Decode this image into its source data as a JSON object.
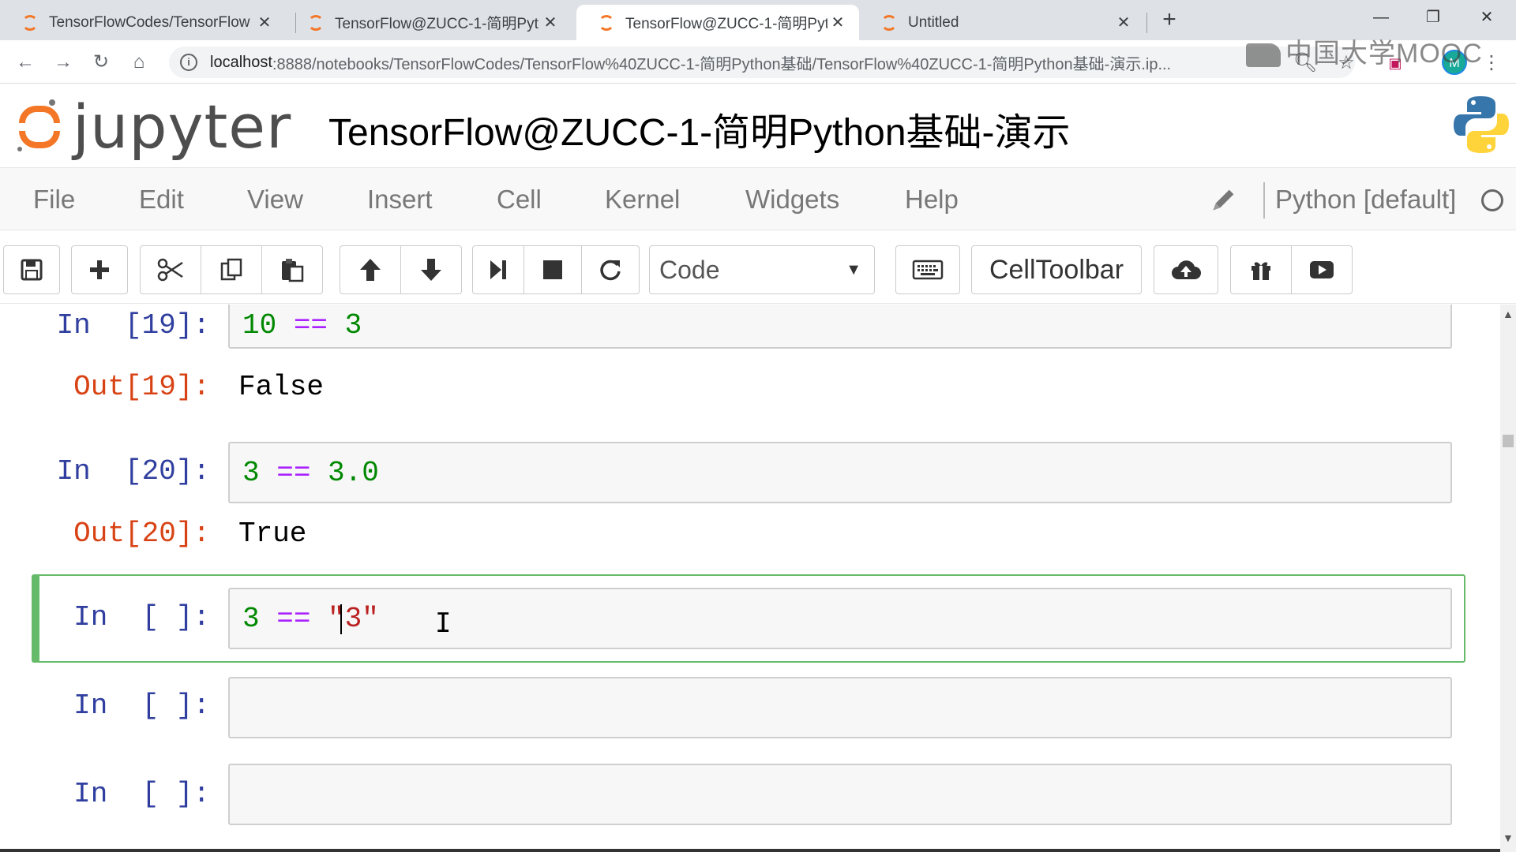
{
  "browser": {
    "tabs": [
      {
        "title": "TensorFlowCodes/TensorFlow",
        "close": "✕"
      },
      {
        "title": "TensorFlow@ZUCC-1-简明Pyt",
        "close": "✕"
      },
      {
        "title": "TensorFlow@ZUCC-1-简明Pyt",
        "close": "✕"
      },
      {
        "title": "Untitled",
        "close": "✕"
      }
    ],
    "active_tab_index": 2,
    "new_tab": "+",
    "window_controls": {
      "minimize": "—",
      "restore": "❐",
      "close": "✕"
    },
    "nav": {
      "back": "←",
      "forward": "→",
      "reload": "↻",
      "home": "⌂"
    },
    "url_host": "localhost",
    "url_path": ":8888/notebooks/TensorFlowCodes/TensorFlow%40ZUCC-1-简明Python基础/TensorFlow%40ZUCC-1-简明Python基础-演示.ip...",
    "profile_initial": "M"
  },
  "watermark": "中国大学MOOC",
  "jupyter": {
    "logo_text": "jupyter",
    "notebook_title": "TensorFlow@ZUCC-1-简明Python基础-演示"
  },
  "menu": {
    "items": [
      "File",
      "Edit",
      "View",
      "Insert",
      "Cell",
      "Kernel",
      "Widgets",
      "Help"
    ],
    "kernel_name": "Python [default]"
  },
  "toolbar": {
    "cell_type": "Code",
    "celltoolbar_label": "CellToolbar"
  },
  "cells": [
    {
      "in_prompt": "In  [19]:",
      "code": {
        "a": "10",
        "op": "==",
        "b": "3"
      },
      "out_prompt": "Out[19]:",
      "output": "False"
    },
    {
      "in_prompt": "In  [20]:",
      "code": {
        "a": "3",
        "op": "==",
        "b": "3.0"
      },
      "out_prompt": "Out[20]:",
      "output": "True"
    },
    {
      "in_prompt": "In  [ ]:",
      "code": {
        "a": "3",
        "op": "==",
        "b": "\"3\""
      }
    },
    {
      "in_prompt": "In  [ ]:"
    },
    {
      "in_prompt": "In  [ ]:"
    }
  ],
  "colors": {
    "jupyter_orange": "#f37726",
    "prompt_in": "#303f9f",
    "prompt_out": "#d84315",
    "selected_cell_border": "#66bb6a"
  }
}
